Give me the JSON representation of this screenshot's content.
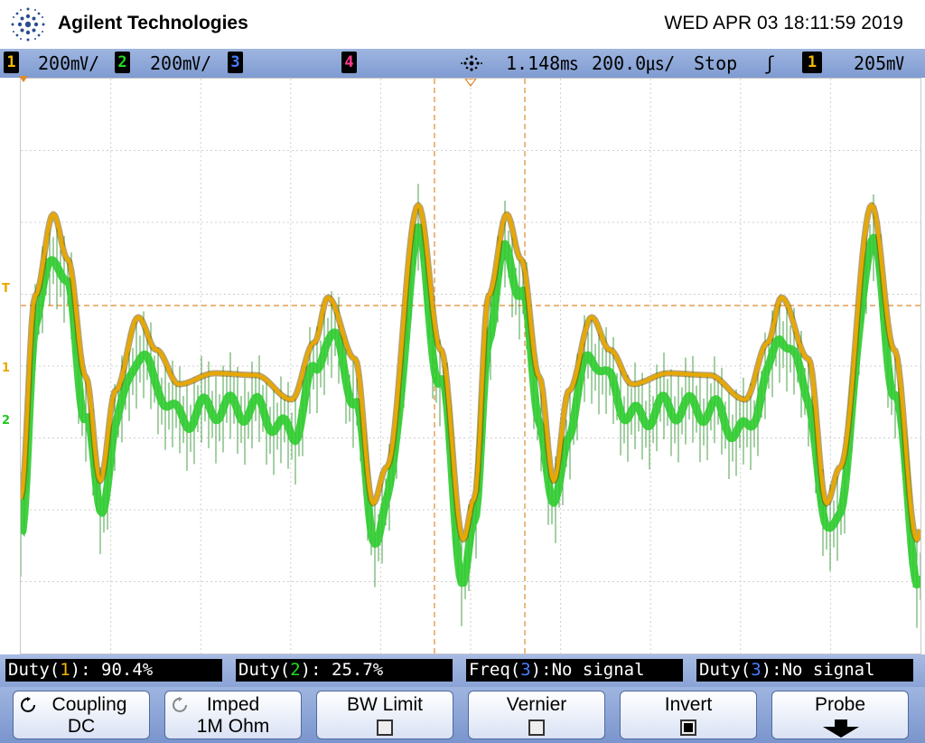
{
  "header": {
    "brand": "Agilent Technologies",
    "datetime": "WED APR 03 18:11:59 2019"
  },
  "status": {
    "ch1": {
      "num": "1",
      "scale": "200",
      "unit": "㎷/"
    },
    "ch2": {
      "num": "2",
      "scale": "200",
      "unit": "㎷/"
    },
    "ch3": {
      "num": "3"
    },
    "ch4": {
      "num": "4"
    },
    "delay": "1.148",
    "delay_unit": "㎳",
    "timebase": "200.0",
    "timebase_unit": "㎲/",
    "run_state": "Stop",
    "trigger_slope": "ʃ",
    "trigger_source": "1",
    "trigger_level": "205",
    "trigger_unit": "㎷"
  },
  "markers": {
    "trigger_level": "T",
    "ch1_ground": "1",
    "ch2_ground": "2"
  },
  "measurements": [
    {
      "name": "Duty",
      "ch": "1",
      "sep": "): ",
      "value": "90.4%"
    },
    {
      "name": "Duty",
      "ch": "2",
      "sep": "): ",
      "value": "25.7%"
    },
    {
      "name": "Freq",
      "ch": "3",
      "sep": "):",
      "value": "No signal"
    },
    {
      "name": "Duty",
      "ch": "3",
      "sep": "):",
      "value": "No signal"
    }
  ],
  "softkeys": {
    "coupling": {
      "label": "Coupling",
      "value": "DC"
    },
    "imped": {
      "label": "Imped",
      "value": "1M Ohm"
    },
    "bw_limit": {
      "label": "BW Limit",
      "checked": false
    },
    "vernier": {
      "label": "Vernier",
      "checked": false
    },
    "invert": {
      "label": "Invert",
      "checked": true
    },
    "probe": {
      "label": "Probe"
    }
  },
  "colors": {
    "ch1": "#f0b800",
    "ch2": "#22dd22",
    "ch3": "#4a7dff",
    "ch4": "#ff3b8f",
    "trace1": "#e8a800",
    "trace2": "#2ecc2e",
    "trace2_dark": "#1a8a1a",
    "grid": "#cfcfcf",
    "cursor": "#e08a2e",
    "status_bg": "#8fa8dc"
  },
  "icons": {
    "logo": "agilent-spark-icon",
    "trigger_position": "trigger-position-icon",
    "coupling": "coupling-icon",
    "imped": "impedance-icon",
    "probe_arrow": "down-arrow-icon"
  }
}
